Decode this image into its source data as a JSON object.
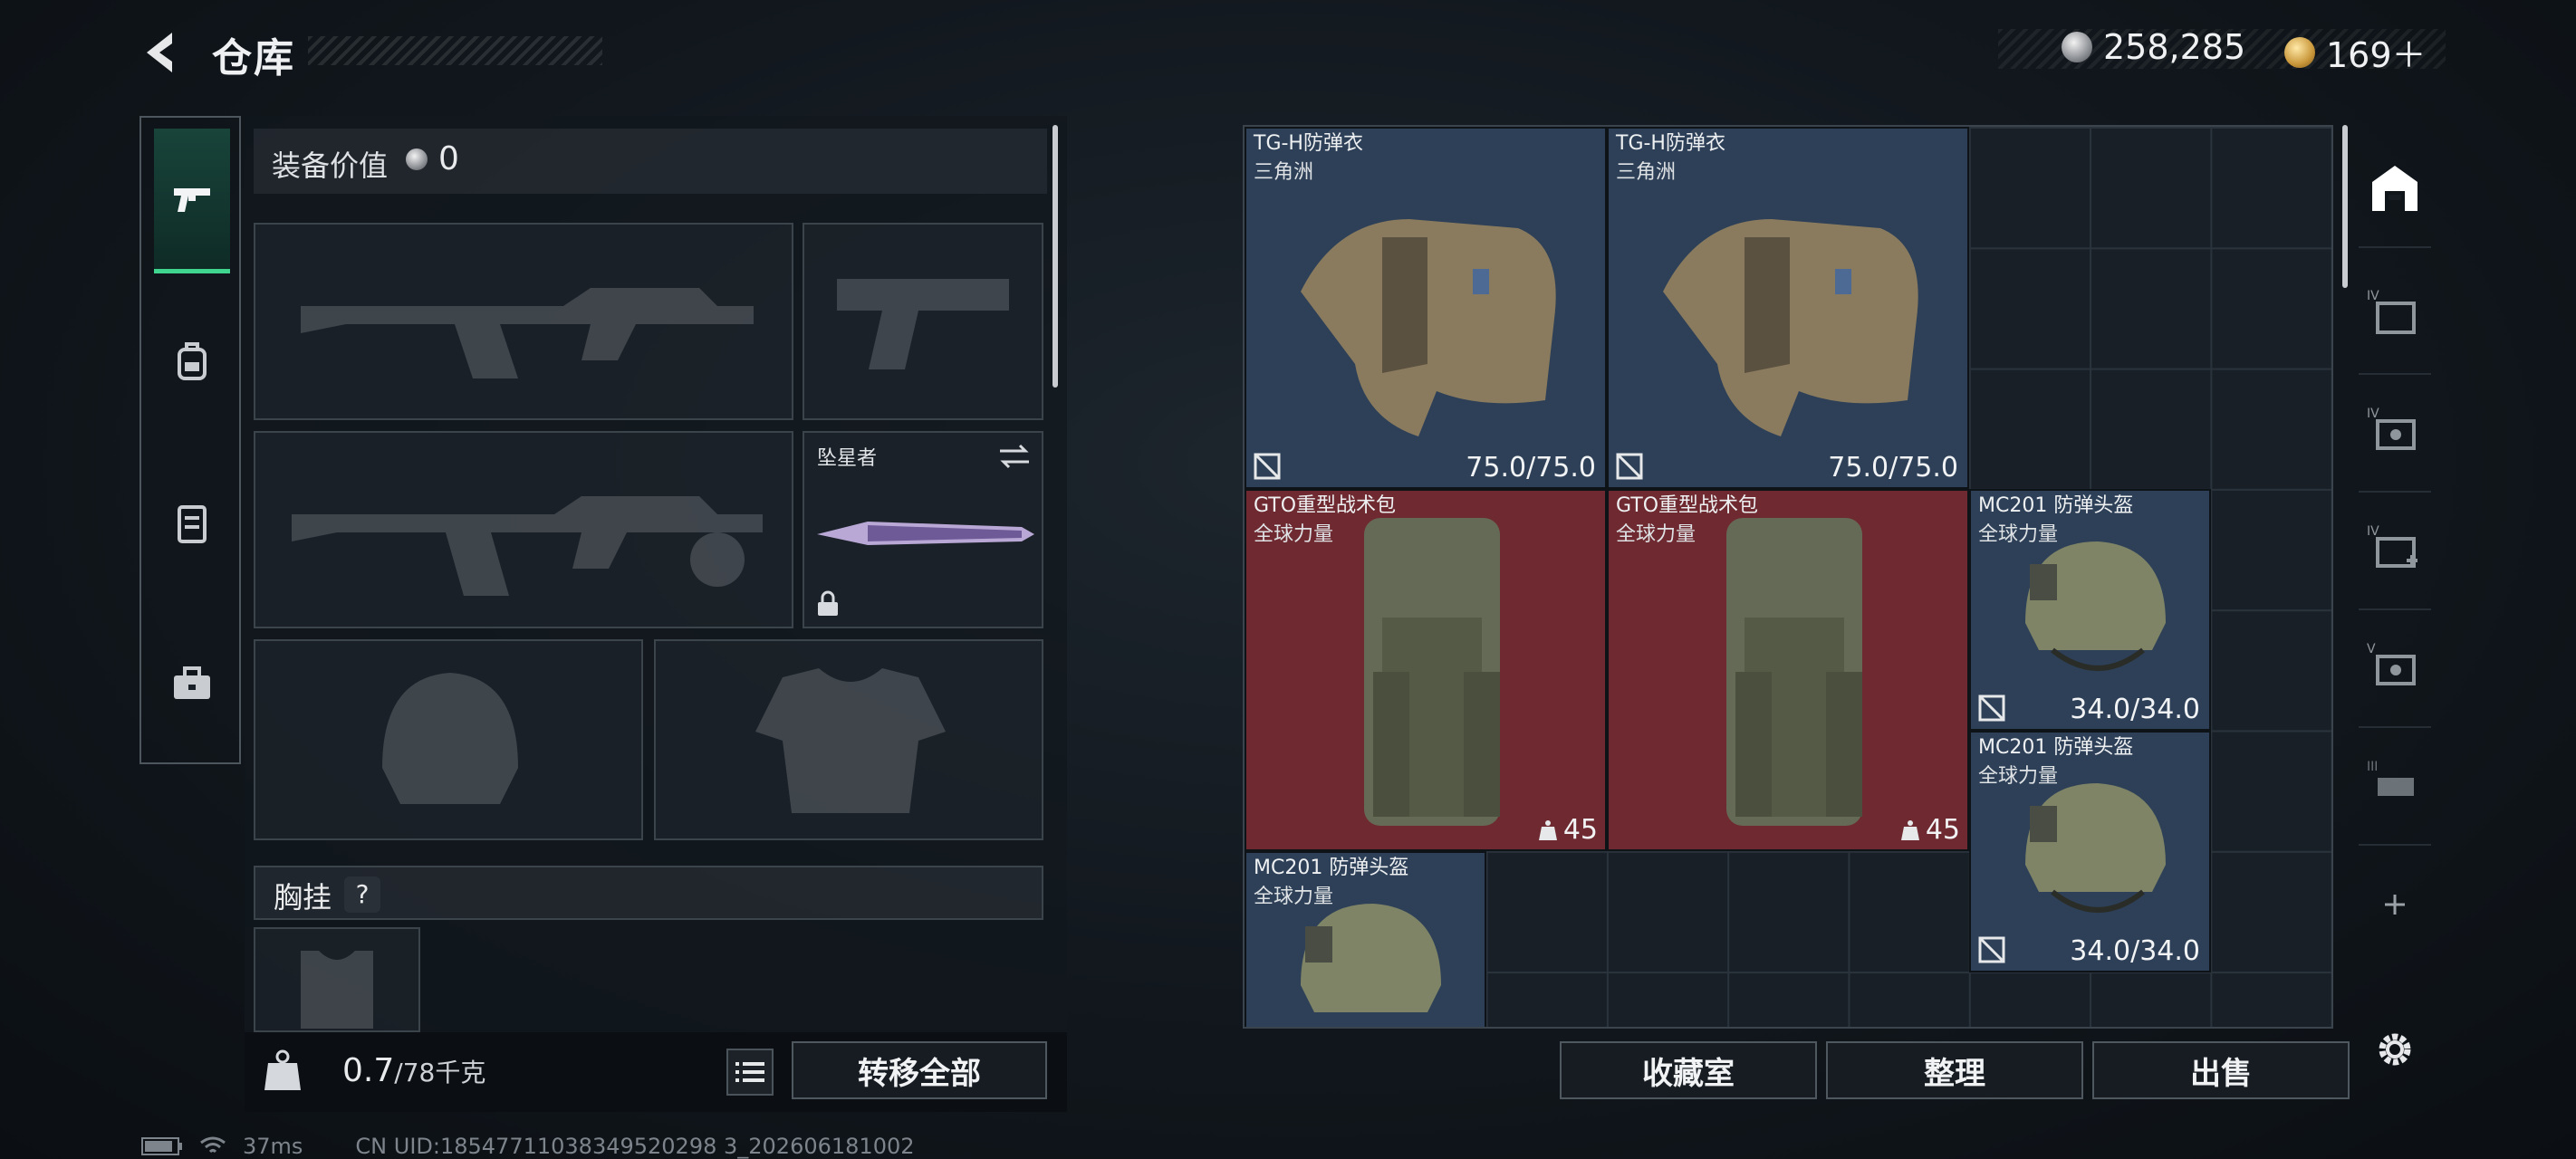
{
  "header": {
    "title": "仓库",
    "currency": [
      {
        "icon": "silver-coin-icon",
        "value": "258,285"
      },
      {
        "icon": "gold-coin-icon",
        "value": "169＋"
      }
    ]
  },
  "left_rail": [
    "pistol-icon",
    "backpack-icon",
    "rig-icon",
    "toolbox-icon"
  ],
  "equip": {
    "value_label": "装备价值",
    "value": "0",
    "melee_name": "坠星者",
    "chest_rig_label": "胸挂",
    "chest_rig_help": "?",
    "weight": "0.7",
    "weight_max": "/78千克",
    "transfer_all": "转移全部"
  },
  "inventory": {
    "items": [
      {
        "name": "TG-H防弹衣",
        "sub": "三角洲",
        "durability": "75.0/75.0"
      },
      {
        "name": "TG-H防弹衣",
        "sub": "三角洲",
        "durability": "75.0/75.0"
      },
      {
        "name": "GTO重型战术包",
        "sub": "全球力量",
        "capacity": "45"
      },
      {
        "name": "GTO重型战术包",
        "sub": "全球力量",
        "capacity": "45"
      },
      {
        "name": "MC201 防弹头盔",
        "sub": "全球力量",
        "durability": "34.0/34.0"
      },
      {
        "name": "MC201 防弹头盔",
        "sub": "全球力量",
        "durability": "34.0/34.0"
      },
      {
        "name": "MC201 防弹头盔",
        "sub": "全球力量",
        "durability": ""
      }
    ],
    "buttons": {
      "collection": "收藏室",
      "organize": "整理",
      "sell": "出售"
    }
  },
  "right_rail": [
    "warehouse-icon",
    "tab-iv-folder",
    "tab-iv-crate",
    "tab-iv-medkit",
    "tab-v-crate",
    "tab-iii-gun",
    "add-icon"
  ],
  "right_rail_labels": [
    "IV",
    "IV",
    "IV",
    "V",
    "III"
  ],
  "status": {
    "ping": "37ms",
    "uid": "CN UID:18547711038349520298 3_202606181002"
  },
  "colors": {
    "accent_green": "#3fd58e",
    "item_blue": "#2d4057",
    "item_red": "#6e2a30"
  }
}
